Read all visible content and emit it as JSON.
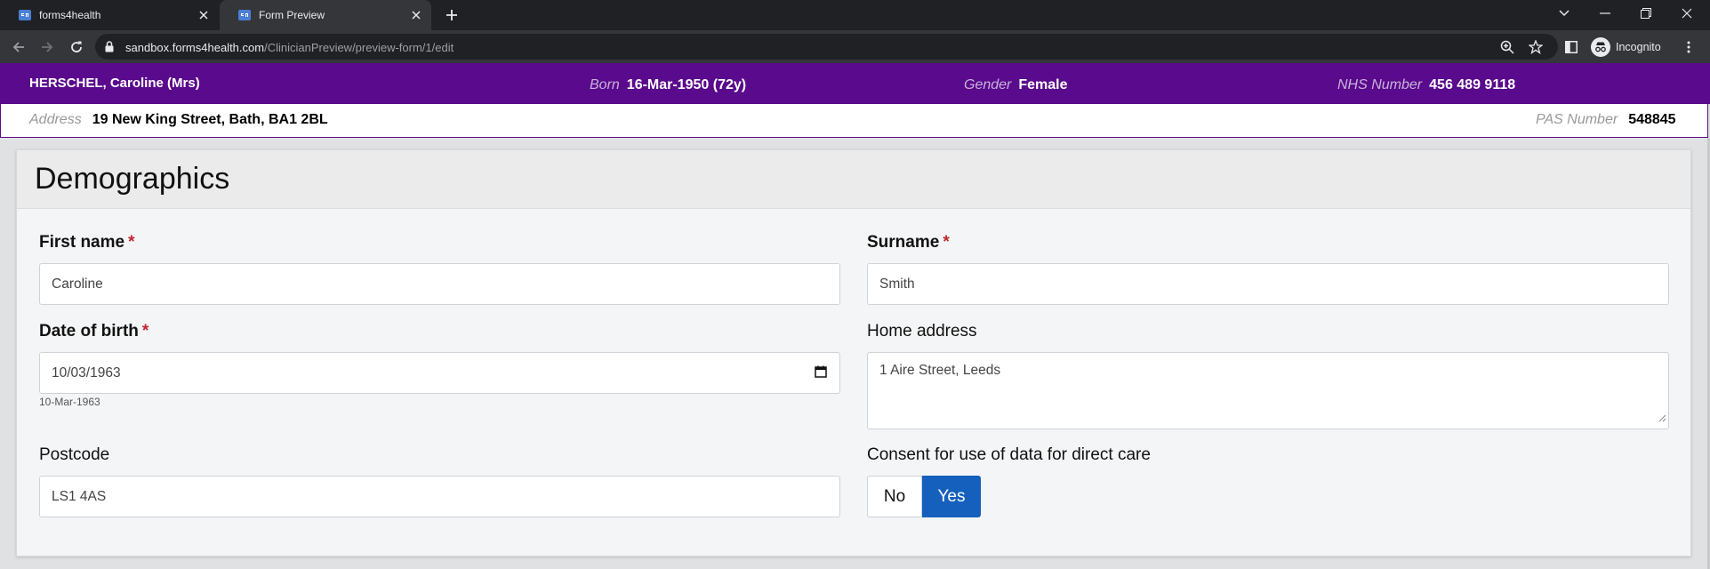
{
  "browser": {
    "tabs": [
      {
        "title": "forms4health",
        "active": false
      },
      {
        "title": "Form Preview",
        "active": true
      }
    ],
    "url_host": "sandbox.forms4health.com",
    "url_path": "/ClinicianPreview/preview-form/1/edit",
    "profile_label": "Incognito"
  },
  "patient": {
    "name": "HERSCHEL, Caroline (Mrs)",
    "born_label": "Born",
    "born_value": "16-Mar-1950 (72y)",
    "gender_label": "Gender",
    "gender_value": "Female",
    "nhs_label": "NHS Number",
    "nhs_value": "456 489 9118",
    "address_label": "Address",
    "address_value": "19 New King Street, Bath, BA1 2BL",
    "pas_label": "PAS Number",
    "pas_value": "548845"
  },
  "form": {
    "title": "Demographics",
    "first_name": {
      "label": "First name",
      "required_mark": "*",
      "value": "Caroline"
    },
    "surname": {
      "label": "Surname",
      "required_mark": "*",
      "value": "Smith"
    },
    "dob": {
      "label": "Date of birth",
      "required_mark": "*",
      "value": "10/03/1963",
      "hint": "10-Mar-1963"
    },
    "home_address": {
      "label": "Home address",
      "value": "1 Aire Street, Leeds"
    },
    "postcode": {
      "label": "Postcode",
      "value": "LS1 4AS"
    },
    "consent": {
      "label": "Consent for use of data for direct care",
      "options": [
        "No",
        "Yes"
      ],
      "selected": "Yes"
    }
  },
  "colors": {
    "banner": "#5a0a8c",
    "selected_toggle": "#1560bd",
    "required": "#c0282d"
  }
}
